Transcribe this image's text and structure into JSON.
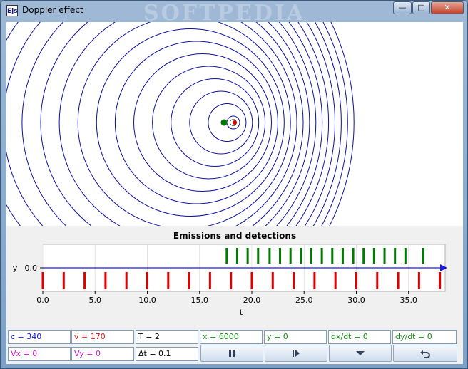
{
  "window": {
    "title": "Doppler effect",
    "app_icon_text": "Ejs",
    "watermark": "SOFTPEDIA",
    "controls": {
      "minimize": "—",
      "maximize": "□",
      "close": "✕"
    }
  },
  "wave_view": {
    "wave_color": "#1010a0",
    "source_color": "#e00000",
    "observer_color": "#007a00"
  },
  "chart_data": {
    "type": "scatter",
    "title": "Emissions and detections",
    "xlabel": "t",
    "ylabel": "y",
    "xlim": [
      0,
      38.5
    ],
    "x_ticks": [
      "0.0",
      "5.0",
      "10.0",
      "15.0",
      "20.0",
      "25.0",
      "30.0",
      "35.0"
    ],
    "y_ticks": [
      "0.0"
    ],
    "grid": true,
    "series": [
      {
        "color": "#e00000",
        "marker": "vertical-bar-below-axis",
        "values": [
          0,
          2,
          4,
          6,
          8,
          10,
          12,
          14,
          16,
          18,
          20,
          22,
          24,
          26,
          28,
          30,
          32,
          34,
          36,
          38
        ]
      },
      {
        "color": "#007a00",
        "marker": "vertical-bar-above-axis",
        "values": [
          17.6,
          18.6,
          19.6,
          20.6,
          21.7,
          22.7,
          23.7,
          24.7,
          25.7,
          26.7,
          27.7,
          28.7,
          29.7,
          30.7,
          31.7,
          32.7,
          33.7,
          34.7,
          36.4
        ]
      }
    ]
  },
  "params": {
    "c": "c = 340",
    "v": "v = 170",
    "T": "T = 2",
    "x": "x = 6000",
    "y": "y = 0",
    "dxdt": "dx/dt = 0",
    "dydt": "dy/dt = 0",
    "Vx": "Vx = 0",
    "Vy": "Vy = 0",
    "dt": "Δt = 0.1"
  },
  "buttons": {
    "pause_icon": "pause-icon",
    "step_icon": "step-forward-icon",
    "menu_icon": "dropdown-icon",
    "reset_icon": "reset-icon"
  }
}
